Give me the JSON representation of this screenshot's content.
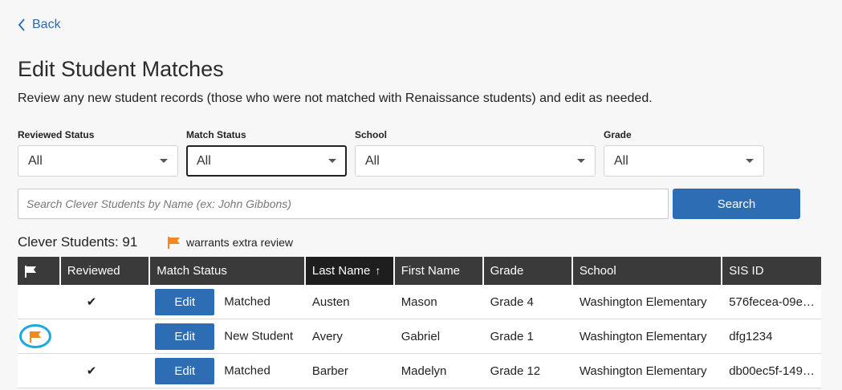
{
  "nav": {
    "back_label": "Back"
  },
  "header": {
    "title": "Edit Student Matches",
    "subtitle": "Review any new student records (those who were not matched with Renaissance students) and edit as needed."
  },
  "filters": [
    {
      "label": "Reviewed Status",
      "value": "All"
    },
    {
      "label": "Match Status",
      "value": "All"
    },
    {
      "label": "School",
      "value": "All"
    },
    {
      "label": "Grade",
      "value": "All"
    }
  ],
  "search": {
    "placeholder": "Search Clever Students by Name (ex: John Gibbons)",
    "button_label": "Search"
  },
  "summary": {
    "count_label": "Clever Students: 91",
    "legend_label": "warrants extra review"
  },
  "table": {
    "columns": [
      "",
      "Reviewed",
      "Match Status",
      "Last Name",
      "First Name",
      "Grade",
      "School",
      "SIS ID"
    ],
    "sort_arrow": "↑",
    "edit_label": "Edit",
    "rows": [
      {
        "flag": false,
        "reviewed": "✔",
        "match_status": "Matched",
        "last_name": "Austen",
        "first_name": "Mason",
        "grade": "Grade 4",
        "school": "Washington Elementary",
        "sis_id": "576fecea-09e…"
      },
      {
        "flag": true,
        "reviewed": "",
        "match_status": "New Student",
        "last_name": "Avery",
        "first_name": "Gabriel",
        "grade": "Grade 1",
        "school": "Washington Elementary",
        "sis_id": "dfg1234"
      },
      {
        "flag": false,
        "reviewed": "✔",
        "match_status": "Matched",
        "last_name": "Barber",
        "first_name": "Madelyn",
        "grade": "Grade 12",
        "school": "Washington Elementary",
        "sis_id": "db00ec5f-149…"
      }
    ]
  },
  "colors": {
    "accent": "#2d6db4",
    "flag": "#f08a1e",
    "highlight": "#1aa8e0",
    "header_bg": "#3a3a3a"
  }
}
